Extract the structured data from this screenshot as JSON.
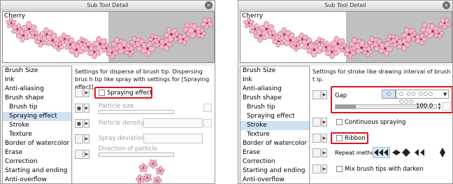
{
  "left": {
    "title": "Sub Tool Detail",
    "preview_label": "Cherry",
    "categories": [
      "Brush Size",
      "Ink",
      "Anti-aliasing",
      "Brush shape",
      "Brush tip",
      "Spraying effect",
      "Stroke",
      "Texture",
      "Border of watercolor",
      "Erase",
      "Correction",
      "Starting and ending",
      "Anti-overflow"
    ],
    "description": "Settings for disperse of brush tip. Dispersing brus h tip like spray with settings for [Spraying effect].",
    "spraying_effect": "Spraying effect",
    "particle_size": "Particle size",
    "particle_density": "Particle density",
    "spray_deviation": "Spray deviation",
    "direction_of_particle": "Direction of particle"
  },
  "right": {
    "title": "Sub Tool Detail",
    "preview_label": "Cherry",
    "categories": [
      "Brush Size",
      "Ink",
      "Anti-aliasing",
      "Brush shape",
      "Brush tip",
      "Spraying effect",
      "Stroke",
      "Texture",
      "Border of watercolor",
      "Erase",
      "Correction",
      "Starting and ending",
      "Anti-overflow"
    ],
    "description": "Settings for stroke like drawing interval of brush t ip.",
    "gap": "Gap",
    "gap_value": "100.0",
    "continuous_spraying": "Continuous spraying",
    "ribbon": "Ribbon",
    "repeat_method": "Repeat method",
    "mix_brush_tips": "Mix brush tips with darken"
  },
  "colors": {
    "highlight": "#e0141e",
    "selection": "#cfe1f3",
    "petal": "#f2b8c8"
  }
}
